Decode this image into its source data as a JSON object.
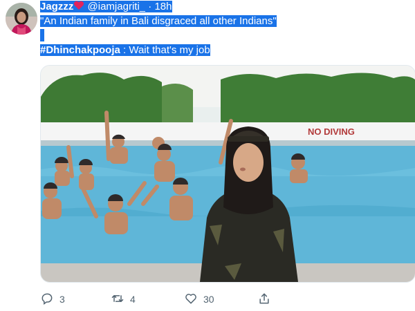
{
  "tweet": {
    "display_name": "Jagzzz",
    "handle": "@iamjagriti_",
    "separator": "·",
    "time": "18h",
    "quote_line": "\"An Indian family in Bali disgraced all other Indians\"",
    "hashtag": "#Dhinchakpooja",
    "rest_line": " : Wait that's my job"
  },
  "media": {
    "sign_text": "NO DIVING"
  },
  "actions": {
    "replies": "3",
    "retweets": "4",
    "likes": "30"
  },
  "colors": {
    "highlight": "#1a73e8",
    "heart": "#e0245e",
    "icon": "#536471"
  },
  "icons": [
    "heart-emoji-icon",
    "reply-icon",
    "retweet-icon",
    "like-icon",
    "share-icon"
  ]
}
